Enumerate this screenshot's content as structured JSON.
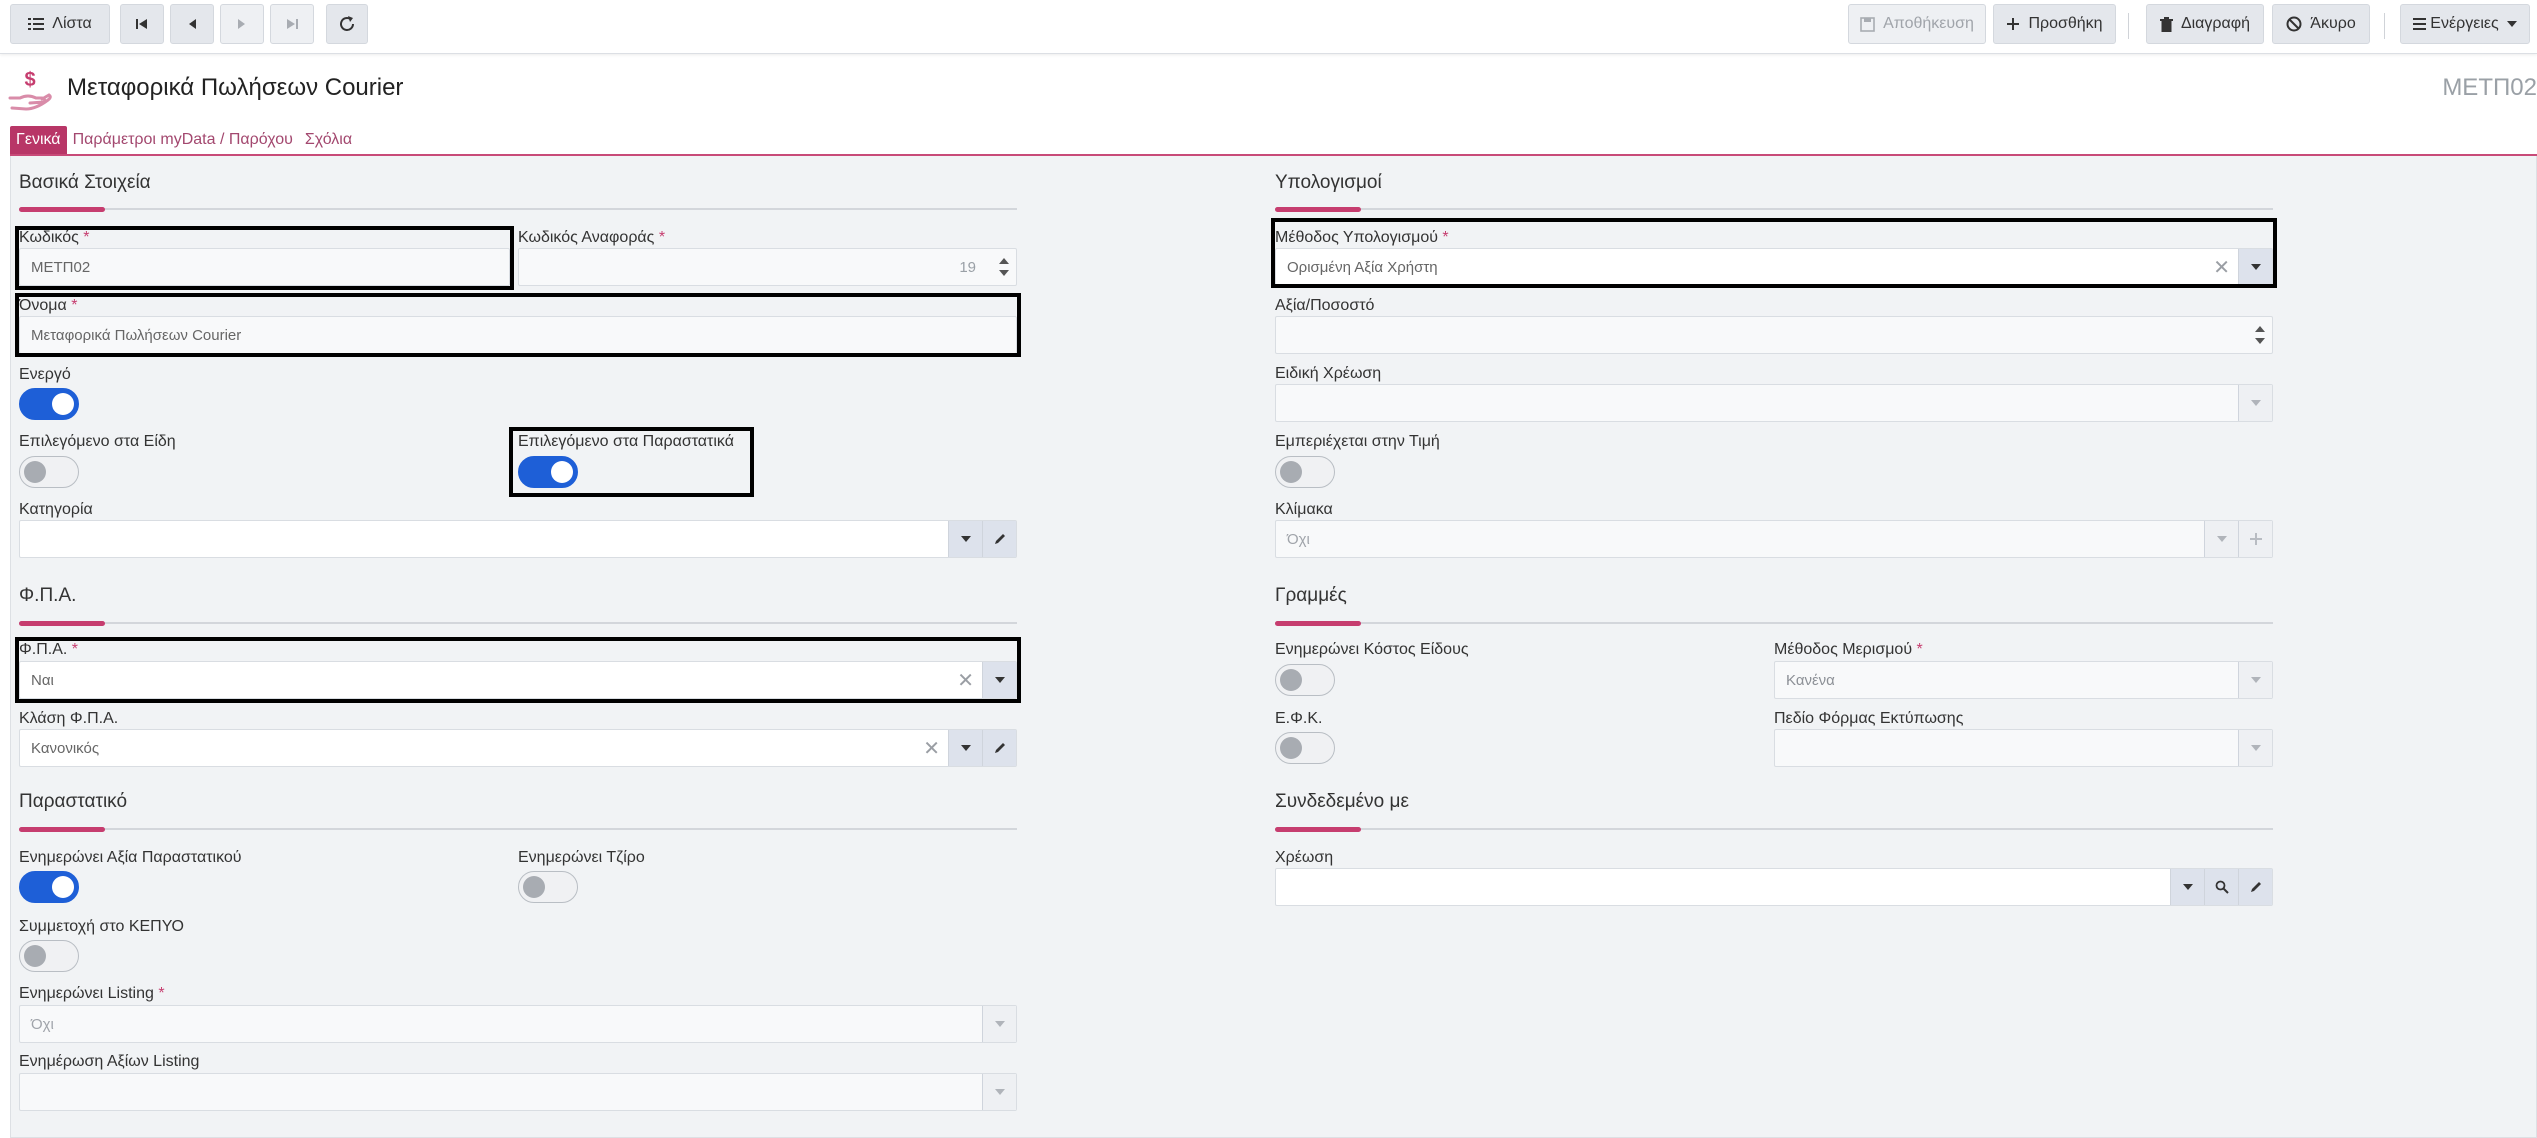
{
  "toolbar": {
    "list_label": "Λίστα",
    "save_label": "Αποθήκευση",
    "add_label": "Προσθήκη",
    "delete_label": "Διαγραφή",
    "cancel_label": "Άκυρο",
    "actions_label": "Ενέργειες"
  },
  "header": {
    "title": "Μεταφορικά Πωλήσεων Courier",
    "code": "ΜΕΤΠ02"
  },
  "tabs": [
    "Γενικά",
    "Παράμετροι myData / Παρόχου",
    "Σχόλια"
  ],
  "basic": {
    "title": "Βασικά Στοιχεία",
    "code_label": "Κωδικός",
    "code_value": "ΜΕΤΠ02",
    "ref_label": "Κωδικός Αναφοράς",
    "ref_value": "19",
    "name_label": "Όνομα",
    "name_value": "Μεταφορικά Πωλήσεων Courier",
    "active_label": "Ενεργό",
    "sel_items_label": "Επιλεγόμενο στα Είδη",
    "sel_docs_label": "Επιλεγόμενο στα Παραστατικά",
    "category_label": "Κατηγορία",
    "category_value": ""
  },
  "vat": {
    "title": "Φ.Π.Α.",
    "vat_label": "Φ.Π.Α.",
    "vat_value": "Ναι",
    "class_label": "Κλάση Φ.Π.Α.",
    "class_value": "Κανονικός"
  },
  "doc": {
    "title": "Παραστατικό",
    "upd_doc_value_label": "Ενημερώνει Αξία Παραστατικού",
    "upd_turnover_label": "Ενημερώνει Τζίρο",
    "kepyo_label": "Συμμετοχή στο ΚΕΠΥΟ",
    "upd_listing_label": "Ενημερώνει Listing",
    "upd_listing_value": "Όχι",
    "listing_values_label": "Ενημέρωση Αξίων Listing",
    "listing_values_value": ""
  },
  "calc": {
    "title": "Υπολογισμοί",
    "method_label": "Μέθοδος Υπολογισμού",
    "method_value": "Ορισμένη Αξία Χρήστη",
    "value_label": "Αξία/Ποσοστό",
    "value_value": "",
    "special_label": "Ειδική Χρέωση",
    "special_value": "",
    "incl_label": "Εμπεριέχεται στην Τιμή",
    "scale_label": "Κλίμακα",
    "scale_value": "Όχι"
  },
  "lines": {
    "title": "Γραμμές",
    "upd_cost_label": "Ενημερώνει Κόστος Είδους",
    "split_label": "Μέθοδος Μερισμού",
    "split_value": "Κανένα",
    "efk_label": "Ε.Φ.Κ.",
    "print_label": "Πεδίο Φόρμας Εκτύπωσης",
    "print_value": ""
  },
  "linked": {
    "title": "Συνδεδεμένο με",
    "charge_label": "Χρέωση",
    "charge_value": ""
  },
  "toggles": {
    "active": true,
    "sel_items": false,
    "sel_docs": true,
    "incl_price": false,
    "upd_cost": false,
    "efk": false,
    "upd_doc_value": true,
    "upd_turnover": false,
    "kepyo": false
  },
  "colors": {
    "accent": "#c63d6f",
    "toggle_on": "#1e5fd7"
  }
}
